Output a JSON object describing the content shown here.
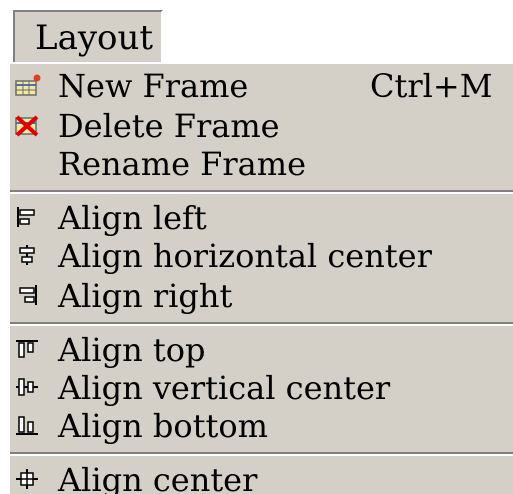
{
  "menubar": {
    "title": "Layout"
  },
  "menu": {
    "items": [
      {
        "label": "New Frame",
        "shortcut": "Ctrl+M",
        "icon": "new-frame-icon"
      },
      {
        "label": "Delete Frame",
        "shortcut": "",
        "icon": "delete-frame-icon"
      },
      {
        "label": "Rename Frame",
        "shortcut": "",
        "icon": ""
      },
      {
        "label": "Align left",
        "shortcut": "",
        "icon": "align-left-icon"
      },
      {
        "label": "Align horizontal center",
        "shortcut": "",
        "icon": "align-horizontal-center-icon"
      },
      {
        "label": "Align right",
        "shortcut": "",
        "icon": "align-right-icon"
      },
      {
        "label": "Align top",
        "shortcut": "",
        "icon": "align-top-icon"
      },
      {
        "label": "Align vertical center",
        "shortcut": "",
        "icon": "align-vertical-center-icon"
      },
      {
        "label": "Align bottom",
        "shortcut": "",
        "icon": "align-bottom-icon"
      },
      {
        "label": "Align center",
        "shortcut": "",
        "icon": "align-center-icon"
      }
    ]
  },
  "colors": {
    "menu_background": "#d4d0c8",
    "separator_shadow": "#808080",
    "delete_icon_red": "#e00000"
  }
}
